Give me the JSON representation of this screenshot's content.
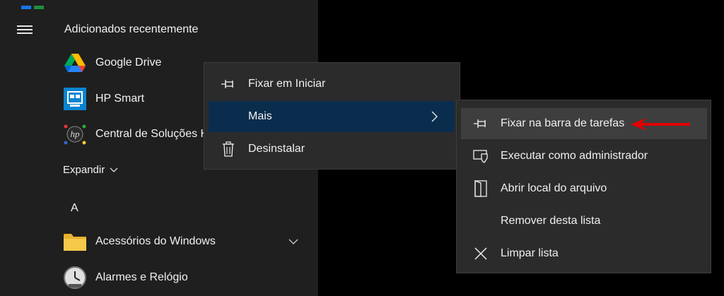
{
  "start_menu": {
    "section_title": "Adicionados recentemente",
    "apps": [
      {
        "label": "Google Drive",
        "icon": "google-drive-icon"
      },
      {
        "label": "HP Smart",
        "icon": "hp-smart-icon"
      },
      {
        "label": "Central de Soluções HP",
        "icon": "hp-logo-icon"
      }
    ],
    "expand_label": "Expandir",
    "letter_heading": "A",
    "apps_a": [
      {
        "label": "Acessórios do Windows",
        "icon": "folder-icon"
      },
      {
        "label": "Alarmes e Relógio",
        "icon": "clock-icon"
      }
    ]
  },
  "context_menu": {
    "items": [
      {
        "label": "Fixar em Iniciar",
        "icon": "pin-icon"
      },
      {
        "label": "Mais",
        "icon": ""
      },
      {
        "label": "Desinstalar",
        "icon": "trash-icon"
      }
    ]
  },
  "submenu": {
    "items": [
      {
        "label": "Fixar na barra de tarefas",
        "icon": "pin-icon"
      },
      {
        "label": "Executar como administrador",
        "icon": "shield-icon"
      },
      {
        "label": "Abrir local do arquivo",
        "icon": "open-file-location-icon"
      },
      {
        "label": "Remover desta lista",
        "icon": ""
      },
      {
        "label": "Limpar lista",
        "icon": "close-icon"
      }
    ]
  },
  "colors": {
    "menu_bg": "#2b2b2b",
    "start_bg": "#1f1f1f",
    "active_item": "#0b2d4d",
    "hover_item": "#3e3e3e",
    "annotation_arrow": "#e00000"
  }
}
